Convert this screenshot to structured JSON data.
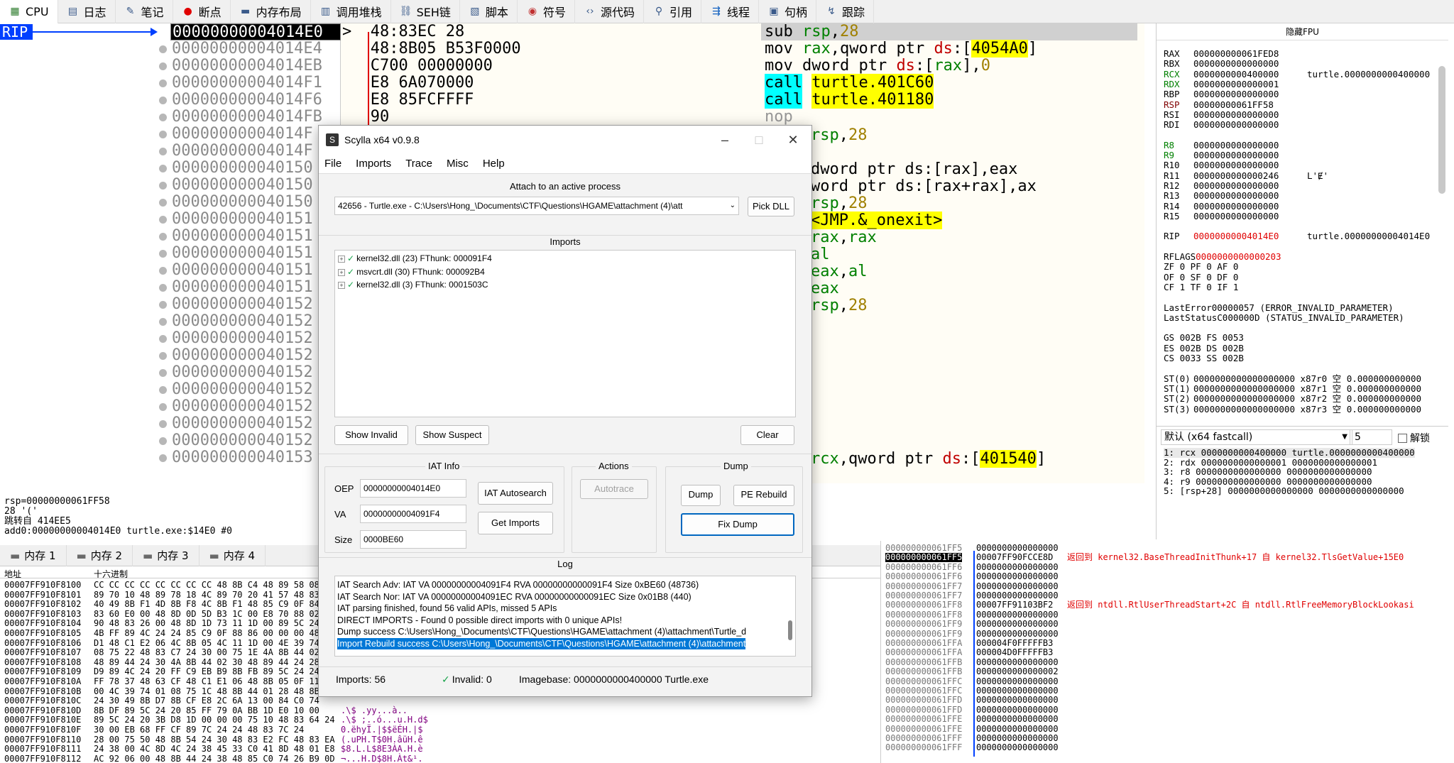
{
  "tabs": [
    {
      "label": "CPU",
      "icon": "cpu-icon"
    },
    {
      "label": "日志",
      "icon": "log-icon"
    },
    {
      "label": "笔记",
      "icon": "notes-icon"
    },
    {
      "label": "断点",
      "icon": "breakpoint-icon"
    },
    {
      "label": "内存布局",
      "icon": "memory-map-icon"
    },
    {
      "label": "调用堆栈",
      "icon": "callstack-icon"
    },
    {
      "label": "SEH链",
      "icon": "seh-icon"
    },
    {
      "label": "脚本",
      "icon": "script-icon"
    },
    {
      "label": "符号",
      "icon": "symbols-icon"
    },
    {
      "label": "源代码",
      "icon": "source-icon"
    },
    {
      "label": "引用",
      "icon": "references-icon"
    },
    {
      "label": "线程",
      "icon": "threads-icon"
    },
    {
      "label": "句柄",
      "icon": "handles-icon"
    },
    {
      "label": "跟踪",
      "icon": "trace-icon"
    }
  ],
  "disasm": {
    "rip_label": "RIP",
    "addresses": [
      "00000000004014E0",
      "00000000004014E4",
      "00000000004014EB",
      "00000000004014F1",
      "00000000004014F6",
      "00000000004014FB",
      "00000000004014F",
      "00000000004014F",
      "000000000040150",
      "000000000040150",
      "000000000040150",
      "000000000040151",
      "000000000040151",
      "000000000040151",
      "000000000040151",
      "000000000040151",
      "000000000040152",
      "000000000040152",
      "000000000040152",
      "000000000040152",
      "000000000040152",
      "000000000040152",
      "000000000040152",
      "000000000040152",
      "000000000040152",
      "000000000040153"
    ],
    "bytes": [
      ">  48:83EC 28",
      "   48:8B05 B53F0000",
      "   C700 00000000",
      "   E8 6A070000",
      "   E8 85FCFFFF",
      "   90"
    ],
    "mnemonics": [
      [
        {
          "t": "sub "
        },
        {
          "t": "rsp",
          "c": "kw-reg"
        },
        {
          "t": ","
        },
        {
          "t": "28",
          "c": "kw-num"
        }
      ],
      [
        {
          "t": "mov "
        },
        {
          "t": "rax",
          "c": "kw-reg"
        },
        {
          "t": ",qword ptr "
        },
        {
          "t": "ds",
          "c": "kw-seg"
        },
        {
          "t": ":["
        },
        {
          "t": "4054A0",
          "c": "hl-y"
        },
        {
          "t": "]"
        }
      ],
      [
        {
          "t": "mov dword ptr "
        },
        {
          "t": "ds",
          "c": "kw-seg"
        },
        {
          "t": ":["
        },
        {
          "t": "rax",
          "c": "kw-reg"
        },
        {
          "t": "],"
        },
        {
          "t": "0",
          "c": "kw-num"
        }
      ],
      [
        {
          "t": "call",
          "c": "hl-c"
        },
        {
          "t": " "
        },
        {
          "t": "turtle.401C60",
          "c": "hl-y"
        }
      ],
      [
        {
          "t": "call",
          "c": "hl-c"
        },
        {
          "t": " "
        },
        {
          "t": "turtle.401180",
          "c": "hl-y"
        }
      ],
      [
        {
          "t": "nop",
          "c": "kw-gray"
        }
      ]
    ],
    "right_fragments": [
      {
        "row": 7,
        "parts": [
          {
            "t": "rsp",
            "c": "kw-reg"
          },
          {
            "t": ","
          },
          {
            "t": "28",
            "c": "kw-num"
          }
        ]
      },
      {
        "row": 9,
        "parts": [
          {
            "t": "dword ptr ds:[rax],eax"
          }
        ]
      },
      {
        "row": 10,
        "parts": [
          {
            "t": "word ptr ds:[rax+rax],ax"
          }
        ]
      },
      {
        "row": 11,
        "parts": [
          {
            "t": "rsp",
            "c": "kw-reg"
          },
          {
            "t": ","
          },
          {
            "t": "28",
            "c": "kw-num"
          }
        ]
      },
      {
        "row": 12,
        "parts": [
          {
            "t": "<JMP.&_onexit>",
            "c": "hl-y"
          }
        ]
      },
      {
        "row": 13,
        "parts": [
          {
            "t": "rax",
            "c": "kw-reg"
          },
          {
            "t": ","
          },
          {
            "t": "rax",
            "c": "kw-reg"
          }
        ]
      },
      {
        "row": 14,
        "parts": [
          {
            "t": "al",
            "c": "kw-reg"
          }
        ]
      },
      {
        "row": 15,
        "parts": [
          {
            "t": "eax",
            "c": "kw-reg"
          },
          {
            "t": ","
          },
          {
            "t": "al",
            "c": "kw-reg"
          }
        ]
      },
      {
        "row": 16,
        "parts": [
          {
            "t": "eax",
            "c": "kw-reg"
          }
        ]
      },
      {
        "row": 17,
        "parts": [
          {
            "t": "rsp",
            "c": "kw-reg"
          },
          {
            "t": ","
          },
          {
            "t": "28",
            "c": "kw-num"
          }
        ]
      },
      {
        "row": 26,
        "parts": [
          {
            "t": "rcx",
            "c": "kw-reg"
          },
          {
            "t": ",qword ptr "
          },
          {
            "t": "ds",
            "c": "kw-seg"
          },
          {
            "t": ":["
          },
          {
            "t": "401540",
            "c": "hl-y"
          },
          {
            "t": "]"
          }
        ]
      }
    ]
  },
  "info": {
    "lines": [
      "rsp=00000000061FF58",
      "28 '('",
      "跳转自 414EE5",
      "add0:00000000004014E0 turtle.exe:$14E0 #0"
    ]
  },
  "registers": {
    "title": "隐藏FPU",
    "lines": [
      {
        "name": "RAX",
        "val": "000000000061FED8",
        "extra": ""
      },
      {
        "name": "RBX",
        "val": "0000000000000000",
        "extra": ""
      },
      {
        "name": "RCX",
        "val": "0000000000400000",
        "extra": "turtle.0000000000400000",
        "c": "#008000"
      },
      {
        "name": "RDX",
        "val": "0000000000000001",
        "extra": "",
        "c": "#008000"
      },
      {
        "name": "RBP",
        "val": "0000000000000000",
        "extra": ""
      },
      {
        "name": "RSP",
        "val": "00000000061FF58",
        "extra": "",
        "c": "#800000"
      },
      {
        "name": "RSI",
        "val": "0000000000000000",
        "extra": ""
      },
      {
        "name": "RDI",
        "val": "0000000000000000",
        "extra": ""
      },
      {
        "name": "",
        "val": "",
        "extra": ""
      },
      {
        "name": "R8",
        "val": "0000000000000000",
        "extra": "",
        "c": "#008000"
      },
      {
        "name": "R9",
        "val": "0000000000000000",
        "extra": "",
        "c": "#008000"
      },
      {
        "name": "R10",
        "val": "0000000000000000",
        "extra": ""
      },
      {
        "name": "R11",
        "val": "0000000000000246",
        "extra": "L'Ɇ'"
      },
      {
        "name": "R12",
        "val": "0000000000000000",
        "extra": ""
      },
      {
        "name": "R13",
        "val": "0000000000000000",
        "extra": ""
      },
      {
        "name": "R14",
        "val": "0000000000000000",
        "extra": ""
      },
      {
        "name": "R15",
        "val": "0000000000000000",
        "extra": ""
      },
      {
        "name": "",
        "val": "",
        "extra": ""
      },
      {
        "name": "RIP",
        "val": "00000000004014E0",
        "extra": "turtle.00000000004014E0",
        "vc": "#e00000"
      },
      {
        "name": "",
        "val": "",
        "extra": ""
      },
      {
        "name": "RFLAGS",
        "val": "0000000000000203",
        "extra": "",
        "vc": "#e00000"
      },
      {
        "name": "ZF 0  PF 0  AF 0",
        "val": "",
        "extra": ""
      },
      {
        "name": "OF 0  SF 0  DF 0",
        "val": "",
        "extra": ""
      },
      {
        "name": "CF 1  TF 0  IF 1",
        "val": "",
        "extra": ""
      },
      {
        "name": "",
        "val": "",
        "extra": ""
      },
      {
        "name": "LastError",
        "val": "00000057 (ERROR_INVALID_PARAMETER)",
        "extra": ""
      },
      {
        "name": "LastStatus",
        "val": "C000000D (STATUS_INVALID_PARAMETER)",
        "extra": ""
      },
      {
        "name": "",
        "val": "",
        "extra": ""
      },
      {
        "name": "GS 002B  FS 0053",
        "val": "",
        "extra": ""
      },
      {
        "name": "ES 002B  DS 002B",
        "val": "",
        "extra": ""
      },
      {
        "name": "CS 0033  SS 002B",
        "val": "",
        "extra": ""
      },
      {
        "name": "",
        "val": "",
        "extra": ""
      },
      {
        "name": "ST(0)",
        "val": "0000000000000000000 x87r0 空 0.000000000000",
        "extra": ""
      },
      {
        "name": "ST(1)",
        "val": "0000000000000000000 x87r1 空 0.000000000000",
        "extra": ""
      },
      {
        "name": "ST(2)",
        "val": "0000000000000000000 x87r2 空 0.000000000000",
        "extra": ""
      },
      {
        "name": "ST(3)",
        "val": "0000000000000000000 x87r3 空 0.000000000000",
        "extra": ""
      }
    ]
  },
  "callconv": {
    "label": "默认 (x64 fastcall)",
    "count": "5",
    "unlock": "解锁",
    "args": [
      "1: rcx 0000000000400000 turtle.0000000000400000",
      "2: rdx 0000000000000001 0000000000000001",
      "3: r8 0000000000000000 0000000000000000",
      "4: r9 0000000000000000 0000000000000000",
      "5: [rsp+28] 0000000000000000 0000000000000000"
    ]
  },
  "memtabs": [
    "内存 1",
    "内存 2",
    "内存 3",
    "内存 4"
  ],
  "dump": {
    "header_addr": "地址",
    "header_hex": "十六进制",
    "rows": [
      {
        "a": "00007FF910F8100",
        "h": "CC CC CC CC CC CC CC CC 48 8B C4 48 89 58 08",
        "s": ""
      },
      {
        "a": "00007FF910F8101",
        "h": "89 70 10 48 89 78 18 4C 89 70 20 41 57 48 83",
        "s": ""
      },
      {
        "a": "00007FF910F8102",
        "h": "40 49 8B F1 4D 8B F8 4C 8B F1 48 85 C9 0F 84",
        "s": ""
      },
      {
        "a": "00007FF910F8103",
        "h": "83 60 E0 00 48 8D 0D 5D B3 1C 00 E8 70 88 02",
        "s": ""
      },
      {
        "a": "00007FF910F8104",
        "h": "90 48 83 26 00 48 8D 1D 73 11 1D 00 89 5C 24",
        "s": ""
      },
      {
        "a": "00007FF910F8105",
        "h": "4B FF 89 4C 24 24 85 C9 0F 88 86 00 00 00 48",
        "s": ""
      },
      {
        "a": "00007FF910F8106",
        "h": "D1 48 C1 E2 06 4C 8B 05 4C 11 1D 00 4E 39 74",
        "s": ""
      },
      {
        "a": "00007FF910F8107",
        "h": "08 75 22 48 83 C7 24 30 00 75 1E 4A 8B 44 02",
        "s": ""
      },
      {
        "a": "00007FF910F8108",
        "h": "48 89 44 24 30 4A 8B 44 02 30 48 89 44 24 28",
        "s": ""
      },
      {
        "a": "00007FF910F8109",
        "h": "D9 89 4C 24 20 FF C9 EB B9 8B FB 89 5C 24 24",
        "s": ""
      },
      {
        "a": "00007FF910F810A",
        "h": "FF 78 37 48 63 CF 48 C1 E1 06 48 8B 05 0F 11",
        "s": ""
      },
      {
        "a": "00007FF910F810B",
        "h": "00 4C 39 74 01 08 75 1C 48 8B 44 01 28 48 8B",
        "s": ""
      },
      {
        "a": "00007FF910F810C",
        "h": "24 30 49 8B D7 8B CF E8 2C 6A 13 00 84 C0 74",
        "s": ""
      },
      {
        "a": "00007FF910F810D",
        "h": "8B DF 89 5C 24 20 85 FF 79 0A BB 1D E0 10 00",
        "s": ".\\$ .yy...à.."
      },
      {
        "a": "00007FF910F810E",
        "h": "89 5C 24 20 3B D8 1D 00 00 00 75 10 48 83 64 24",
        "s": ".\\$ ;..ó...u.H.d$"
      },
      {
        "a": "00007FF910F810F",
        "h": "30 00 EB 68 FF CF 89 7C 24 24 48 83 7C 24",
        "s": "0.ëhyÏ.|$$ëÉH.|$"
      },
      {
        "a": "00007FF910F8110",
        "h": "28 00 75 50 48 8B 54 24 30 48 83 E2 FC 48 83 EA",
        "s": "(.uPH.T$0H.âüH.ê"
      },
      {
        "a": "00007FF910F8111",
        "h": "24 38 00 4C 8D 4C 24 38 45 33 C0 41 8D 48 01 E8",
        "s": "$8.L.L$8E3ÀA.H.è"
      },
      {
        "a": "00007FF910F8112",
        "h": "AC 92 06 00 48 8B 44 24 38 48 85 C0 74 26 B9 0D",
        "s": "¬...H.D$8H.Àt&¹."
      },
      {
        "a": "00007FF910F8113",
        "h": "01 00 00 66 39 48 18 74 0B B9 0D 02 00 00 66 39",
        "s": "...f9H.t.¹....f9"
      }
    ]
  },
  "stack": {
    "rows": [
      {
        "a": "000000000061FF5",
        "v": "0000000000000000",
        "c": ""
      },
      {
        "a": "000000000061FF5",
        "v": "00007FF90FCCE8D",
        "c": "返回到 kernel32.BaseThreadInitThunk+17 自 kernel32.TlsGetValue+15E0",
        "sel": true
      },
      {
        "a": "000000000061FF6",
        "v": "0000000000000000",
        "c": ""
      },
      {
        "a": "000000000061FF6",
        "v": "0000000000000000",
        "c": ""
      },
      {
        "a": "000000000061FF7",
        "v": "0000000000000000",
        "c": ""
      },
      {
        "a": "000000000061FF7",
        "v": "0000000000000000",
        "c": ""
      },
      {
        "a": "000000000061FF8",
        "v": "00007FF91103BF2",
        "c": "返回到 ntdll.RtlUserThreadStart+2C 自 ntdll.RtlFreeMemoryBlockLookasi"
      },
      {
        "a": "000000000061FF8",
        "v": "0000000000000000",
        "c": ""
      },
      {
        "a": "000000000061FF9",
        "v": "0000000000000000",
        "c": ""
      },
      {
        "a": "000000000061FF9",
        "v": "0000000000000000",
        "c": ""
      },
      {
        "a": "000000000061FFA",
        "v": "000004F0FFFFFB3",
        "c": ""
      },
      {
        "a": "000000000061FFA",
        "v": "000004D0FFFFFB3",
        "c": ""
      },
      {
        "a": "000000000061FFB",
        "v": "0000000000000000",
        "c": ""
      },
      {
        "a": "000000000061FFB",
        "v": "0000000000000002",
        "c": ""
      },
      {
        "a": "000000000061FFC",
        "v": "0000000000000000",
        "c": ""
      },
      {
        "a": "000000000061FFC",
        "v": "0000000000000000",
        "c": ""
      },
      {
        "a": "000000000061FFD",
        "v": "0000000000000000",
        "c": ""
      },
      {
        "a": "000000000061FFD",
        "v": "0000000000000000",
        "c": ""
      },
      {
        "a": "000000000061FFE",
        "v": "0000000000000000",
        "c": ""
      },
      {
        "a": "000000000061FFE",
        "v": "0000000000000000",
        "c": ""
      },
      {
        "a": "000000000061FFF",
        "v": "0000000000000000",
        "c": ""
      },
      {
        "a": "000000000061FFF",
        "v": "0000000000000000",
        "c": ""
      }
    ]
  },
  "scylla": {
    "title": "Scylla x64 v0.9.8",
    "menu": [
      "File",
      "Imports",
      "Trace",
      "Misc",
      "Help"
    ],
    "attach_label": "Attach to an active process",
    "process": "42656 - Turtle.exe - C:\\Users\\Hong_\\Documents\\CTF\\Questions\\HGAME\\attachment (4)\\att",
    "pick_dll": "Pick DLL",
    "imports_label": "Imports",
    "imports": [
      "kernel32.dll (23) FThunk: 000091F4",
      "msvcrt.dll (30) FThunk: 000092B4",
      "kernel32.dll (3) FThunk: 0001503C"
    ],
    "show_invalid": "Show Invalid",
    "show_suspect": "Show Suspect",
    "clear": "Clear",
    "iat_label": "IAT Info",
    "oep_label": "OEP",
    "oep": "00000000004014E0",
    "va_label": "VA",
    "va": "00000000004091F4",
    "size_label": "Size",
    "size": "0000BE60",
    "iat_autosearch": "IAT Autosearch",
    "get_imports": "Get Imports",
    "actions_label": "Actions",
    "autotrace": "Autotrace",
    "dump_label": "Dump",
    "dump": "Dump",
    "pe_rebuild": "PE Rebuild",
    "fix_dump": "Fix Dump",
    "log_label": "Log",
    "log": [
      "IAT Search Adv: IAT VA 00000000004091F4 RVA 00000000000091F4 Size 0xBE60 (48736)",
      "IAT Search Nor: IAT VA 00000000004091EC RVA 00000000000091EC Size 0x01B8 (440)",
      "IAT parsing finished, found 56 valid APIs, missed 5 APIs",
      "DIRECT IMPORTS - Found 0 possible direct imports with 0 unique APIs!",
      "Dump success C:\\Users\\Hong_\\Documents\\CTF\\Questions\\HGAME\\attachment (4)\\attachment\\Turtle_d",
      "Import Rebuild success C:\\Users\\Hong_\\Documents\\CTF\\Questions\\HGAME\\attachment (4)\\attachment"
    ],
    "status_imports": "Imports: 56",
    "status_invalid": "Invalid: 0",
    "status_imagebase": "Imagebase: 0000000000400000 Turtle.exe"
  }
}
